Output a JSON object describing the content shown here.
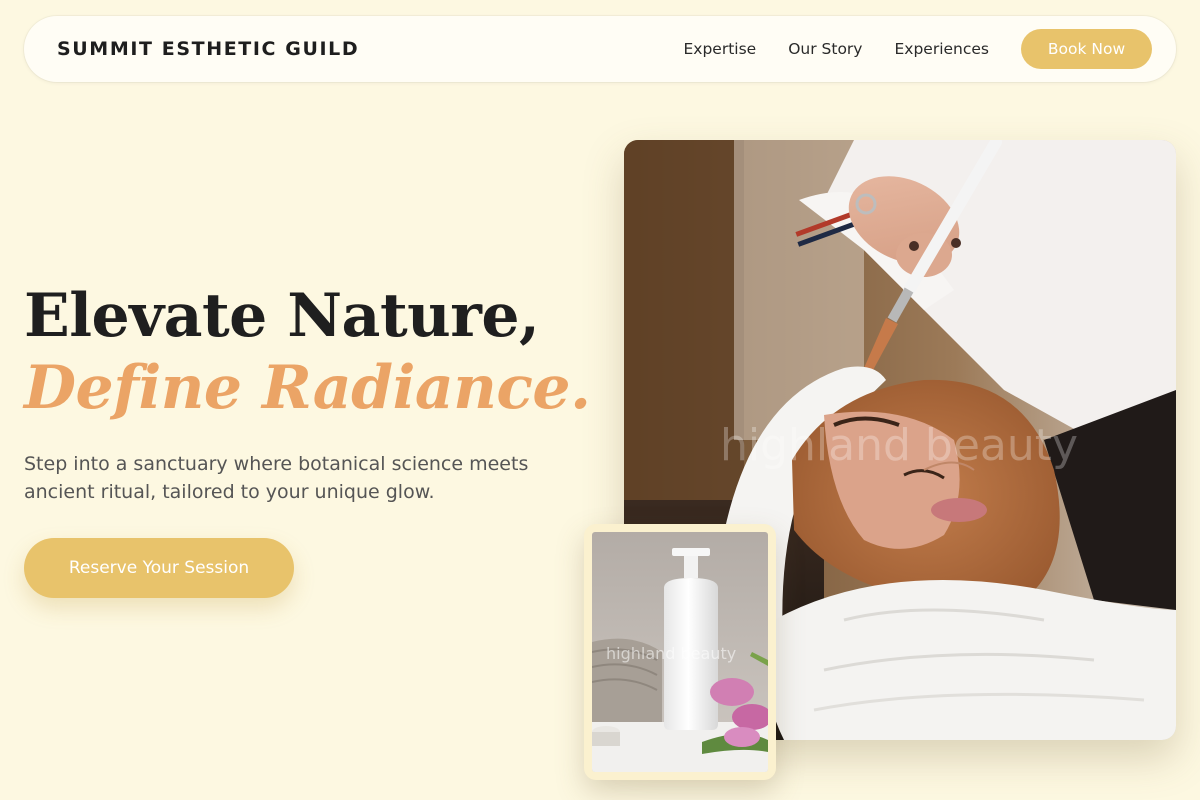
{
  "nav": {
    "brand": "SUMMIT ESTHETIC GUILD",
    "links": [
      {
        "label": "Expertise"
      },
      {
        "label": "Our Story"
      },
      {
        "label": "Experiences"
      }
    ],
    "cta_label": "Book Now"
  },
  "hero": {
    "title_line1": "Elevate Nature,",
    "title_line2": "Define Radiance.",
    "subtitle": "Step into a sanctuary where botanical science meets ancient ritual, tailored to your unique glow.",
    "cta_label": "Reserve Your Session"
  },
  "images": {
    "main_watermark": "highland beauty",
    "small_watermark": "highland beauty"
  },
  "colors": {
    "background": "#fdf8e1",
    "accent_gold": "#e8c36b",
    "accent_peach": "#eba466",
    "text_dark": "#1f1f1f"
  }
}
